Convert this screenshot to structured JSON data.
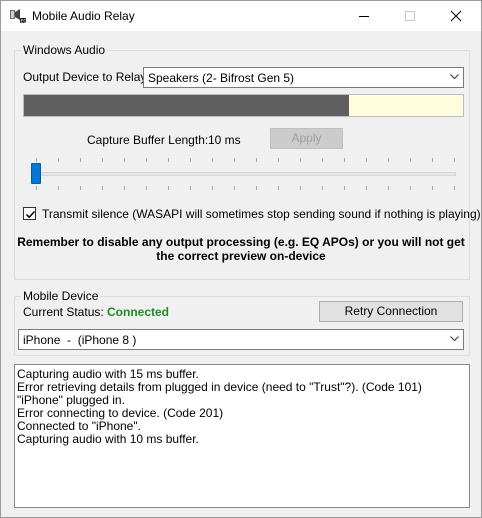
{
  "window": {
    "title": "Mobile Audio Relay",
    "icon": "audio-relay-app-icon"
  },
  "windows_audio": {
    "group_label": "Windows Audio",
    "output_device_label": "Output Device to Relay",
    "output_device_value": "Speakers (2- Bifrost Gen 5)",
    "meter_level_fraction": 0.74,
    "capture_buffer_label": "Capture Buffer Length:",
    "capture_buffer_value": "10 ms",
    "apply_label": "Apply",
    "slider_value_fraction": 0.0,
    "transmit_silence_checked": true,
    "transmit_silence_label": "Transmit silence (WASAPI will sometimes stop sending sound if nothing is playing)",
    "warning_text": "Remember to disable any output processing (e.g. EQ APOs) or you will not get the correct preview on-device"
  },
  "mobile_device": {
    "group_label": "Mobile Device",
    "current_status_label": "Current Status:",
    "current_status_value": "Connected",
    "status_color": "#228b22",
    "retry_label": "Retry Connection",
    "device_value": "iPhone  -  (iPhone 8 )"
  },
  "log": {
    "lines": [
      "Capturing audio with 15 ms buffer.",
      "Error retrieving details from plugged in device (need to \"Trust\"?). (Code 101)",
      "\"iPhone\" plugged in.",
      "Error connecting to device. (Code 201)",
      "Connected to \"iPhone\".",
      "Capturing audio with 10 ms buffer."
    ]
  },
  "colors": {
    "accent": "#0078d7",
    "meter_fill": "#5f5f5f",
    "meter_background": "#ffffe0"
  }
}
